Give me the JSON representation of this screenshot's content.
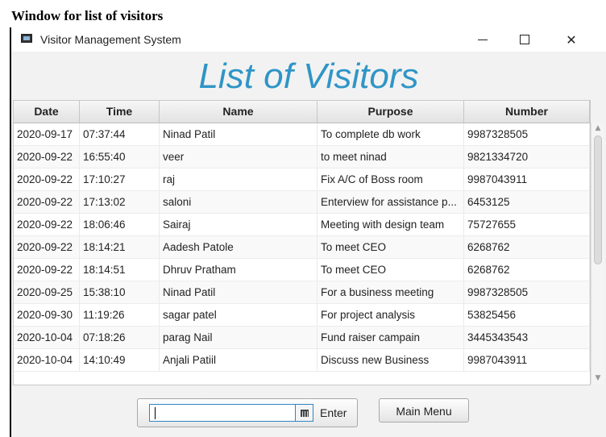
{
  "caption": "Window for list of visitors",
  "window": {
    "title": "Visitor Management System",
    "minimize": "—",
    "maximize": "☐",
    "close": "✕"
  },
  "heading": "List of Visitors",
  "table": {
    "columns": [
      "Date",
      "Time",
      "Name",
      "Purpose",
      "Number"
    ],
    "rows": [
      [
        "2020-09-17",
        "07:37:44",
        "Ninad Patil",
        "To complete db work",
        "9987328505"
      ],
      [
        "2020-09-22",
        "16:55:40",
        "veer",
        "to meet ninad",
        "9821334720"
      ],
      [
        "2020-09-22",
        "17:10:27",
        "raj",
        "Fix A/C of Boss room",
        "9987043911"
      ],
      [
        "2020-09-22",
        "17:13:02",
        "saloni",
        "Enterview for assistance p...",
        "6453125"
      ],
      [
        "2020-09-22",
        "18:06:46",
        "Sairaj",
        "Meeting with design team",
        "75727655"
      ],
      [
        "2020-09-22",
        "18:14:21",
        "Aadesh Patole",
        "To meet CEO",
        "6268762"
      ],
      [
        "2020-09-22",
        "18:14:51",
        "Dhruv Pratham",
        "To meet CEO",
        "6268762"
      ],
      [
        "2020-09-25",
        "15:38:10",
        "Ninad Patil",
        "For a business meeting",
        "9987328505"
      ],
      [
        "2020-09-30",
        "11:19:26",
        "sagar patel",
        "For project analysis",
        "53825456"
      ],
      [
        "2020-10-04",
        "07:18:26",
        "parag Nail",
        "Fund raiser campain",
        "3445343543"
      ],
      [
        "2020-10-04",
        "14:10:49",
        "Anjali Patiil",
        "Discuss new Business",
        "9987043911"
      ]
    ]
  },
  "date_picker": {
    "value": "",
    "icon": "calendar-icon",
    "enter_label": "Enter"
  },
  "main_menu_label": "Main Menu",
  "colors": {
    "heading": "#2f95c6",
    "focus_border": "#2f86c4"
  }
}
